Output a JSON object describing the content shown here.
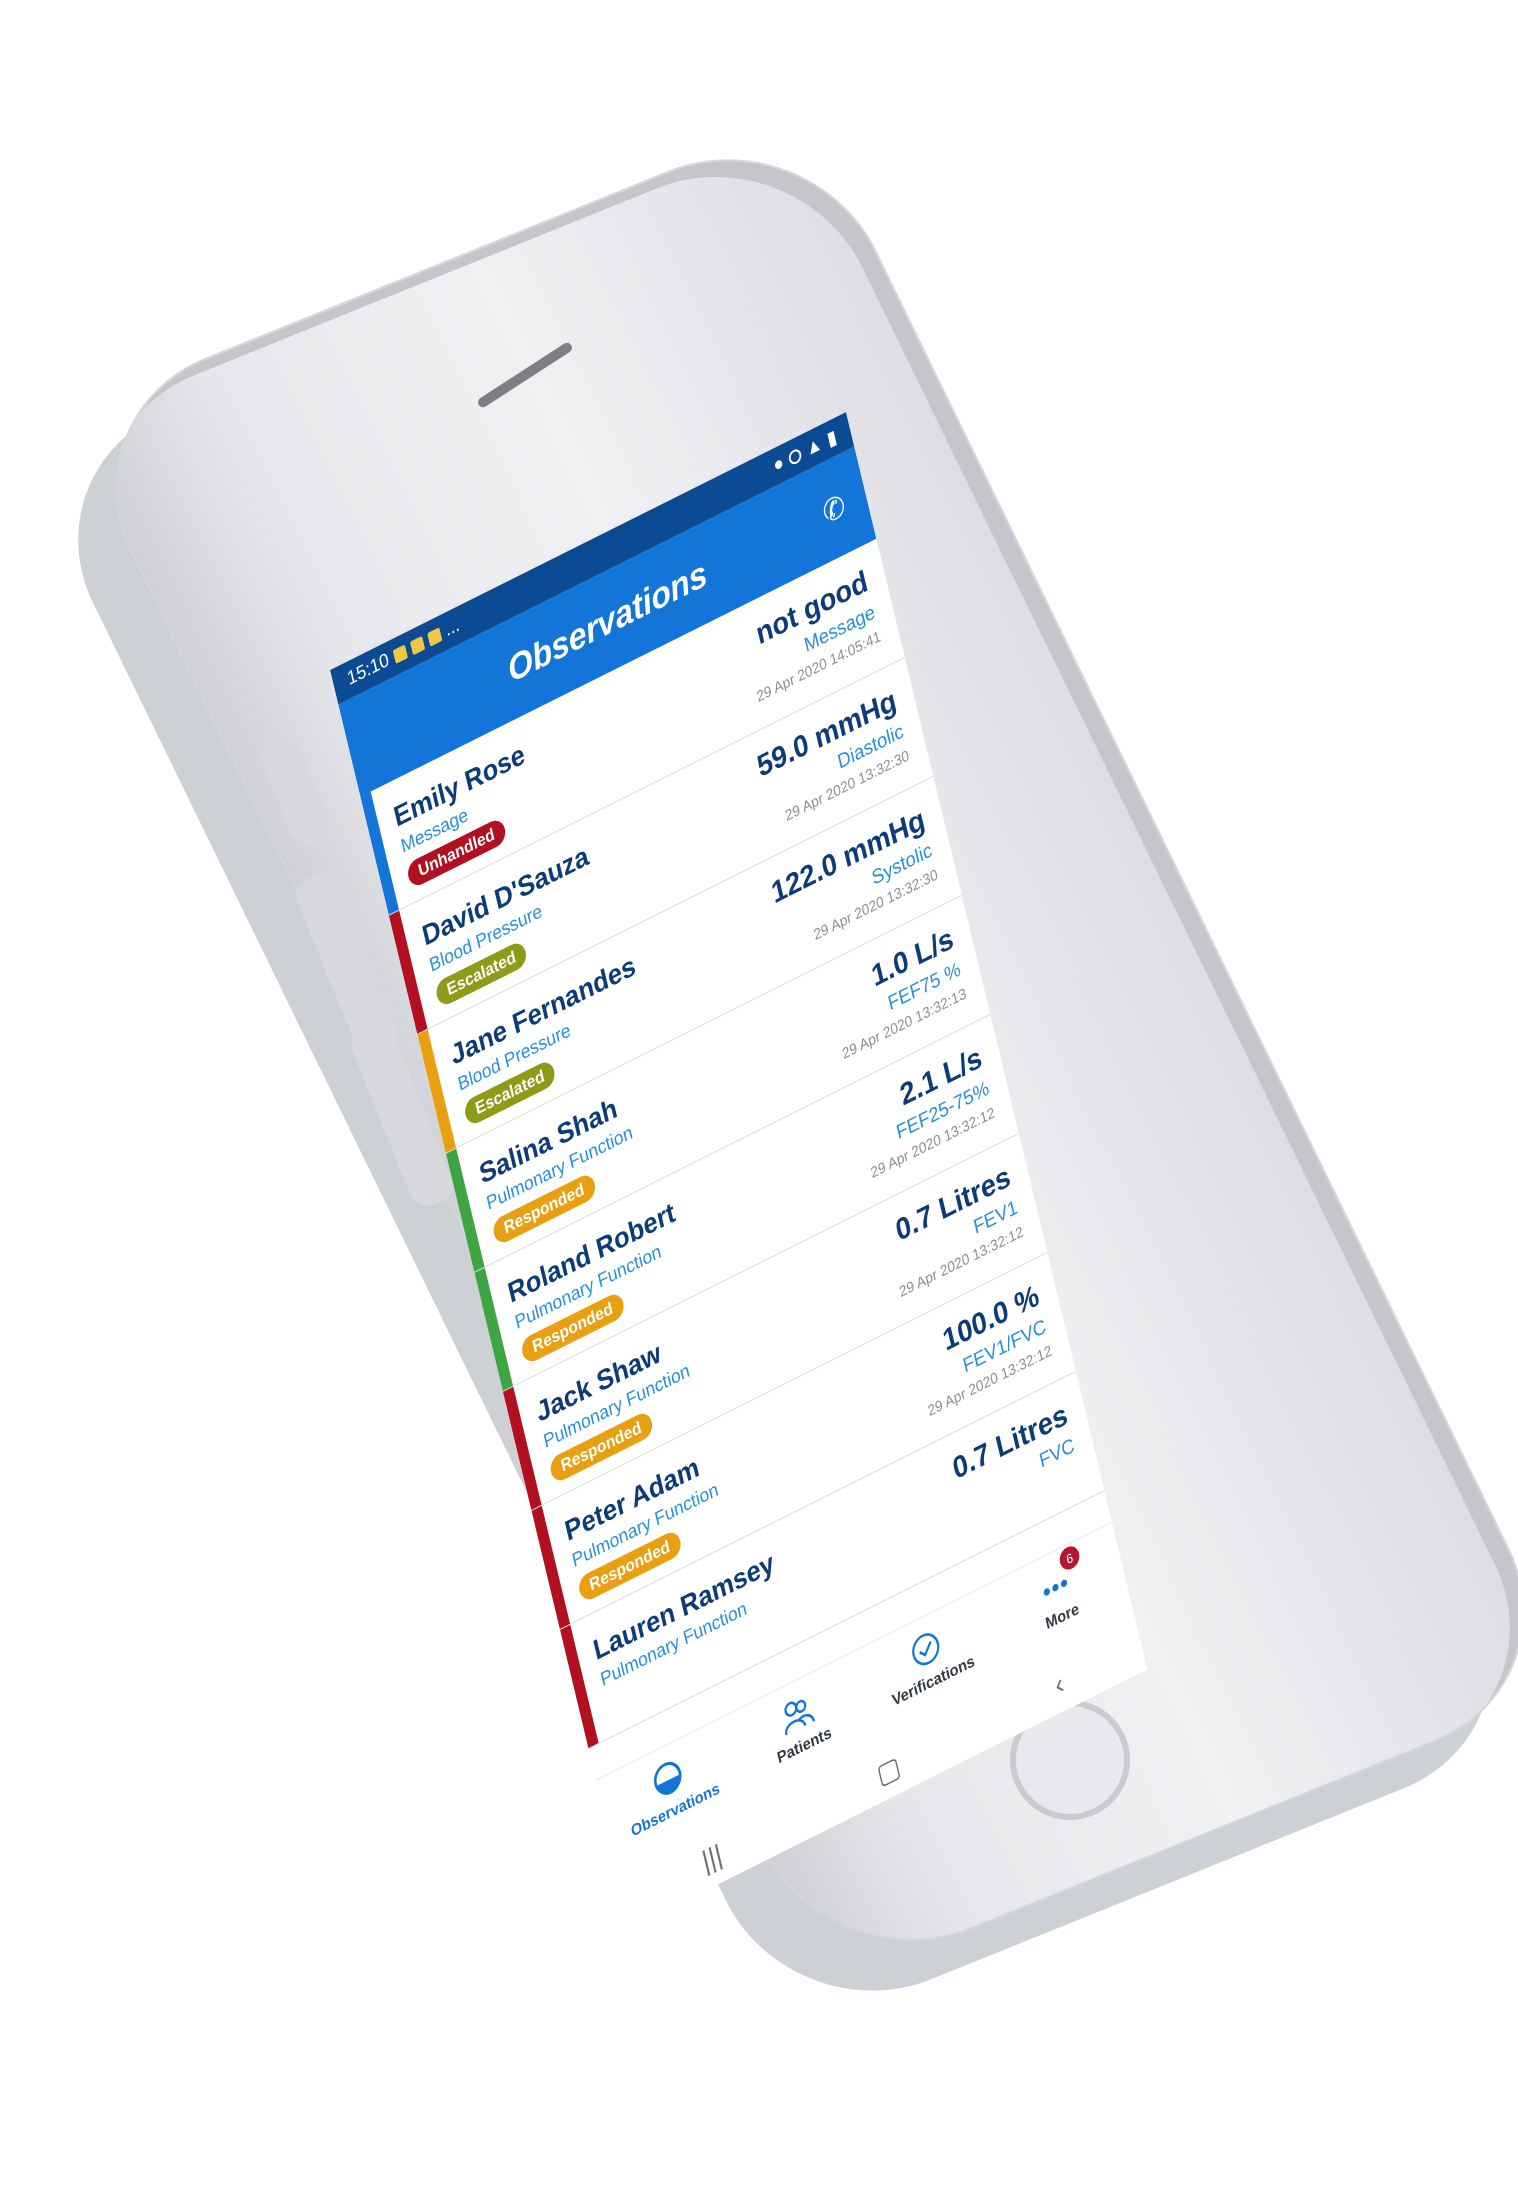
{
  "status_bar": {
    "time": "15:10",
    "ellipsis": "..."
  },
  "app_bar": {
    "title": "Observations"
  },
  "colors": {
    "red": "#b01020",
    "olive": "#8e9a18",
    "orange": "#e8a012",
    "green": "#3ea544",
    "blue": "#1475d9",
    "navy": "#0c4a93"
  },
  "rows": [
    {
      "name": "Emily Rose",
      "type": "Message",
      "badge": "Unhandled",
      "badge_color": "#b01020",
      "accent": "#1475d9",
      "value": "not good",
      "label": "Message",
      "date": "29 Apr 2020 14:05:41"
    },
    {
      "name": "David D'Sauza",
      "type": "Blood Pressure",
      "badge": "Escalated",
      "badge_color": "#8e9a18",
      "accent": "#b01020",
      "value": "59.0 mmHg",
      "label": "Diastolic",
      "date": "29 Apr 2020 13:32:30"
    },
    {
      "name": "Jane Fernandes",
      "type": "Blood Pressure",
      "badge": "Escalated",
      "badge_color": "#8e9a18",
      "accent": "#e8a012",
      "value": "122.0 mmHg",
      "label": "Systolic",
      "date": "29 Apr 2020 13:32:30"
    },
    {
      "name": "Salina Shah",
      "type": "Pulmonary Function",
      "badge": "Responded",
      "badge_color": "#e8a012",
      "accent": "#3ea544",
      "value": "1.0 L/s",
      "label": "FEF75 %",
      "date": "29 Apr 2020 13:32:13"
    },
    {
      "name": "Roland Robert",
      "type": "Pulmonary Function",
      "badge": "Responded",
      "badge_color": "#e8a012",
      "accent": "#3ea544",
      "value": "2.1 L/s",
      "label": "FEF25-75%",
      "date": "29 Apr 2020 13:32:12"
    },
    {
      "name": "Jack Shaw",
      "type": "Pulmonary Function",
      "badge": "Responded",
      "badge_color": "#e8a012",
      "accent": "#b01020",
      "value": "0.7 Litres",
      "label": "FEV1",
      "date": "29 Apr 2020 13:32:12"
    },
    {
      "name": "Peter Adam",
      "type": "Pulmonary Function",
      "badge": "Responded",
      "badge_color": "#e8a012",
      "accent": "#b01020",
      "value": "100.0 %",
      "label": "FEV1/FVC",
      "date": "29 Apr 2020 13:32:12"
    },
    {
      "name": "Lauren Ramsey",
      "type": "Pulmonary Function",
      "badge": "",
      "badge_color": "#e8a012",
      "accent": "#b01020",
      "value": "0.7 Litres",
      "label": "FVC",
      "date": ""
    }
  ],
  "bottom_nav": {
    "observations": "Observations",
    "patients": "Patients",
    "verifications": "Verifications",
    "more": "More",
    "more_badge": "6"
  }
}
